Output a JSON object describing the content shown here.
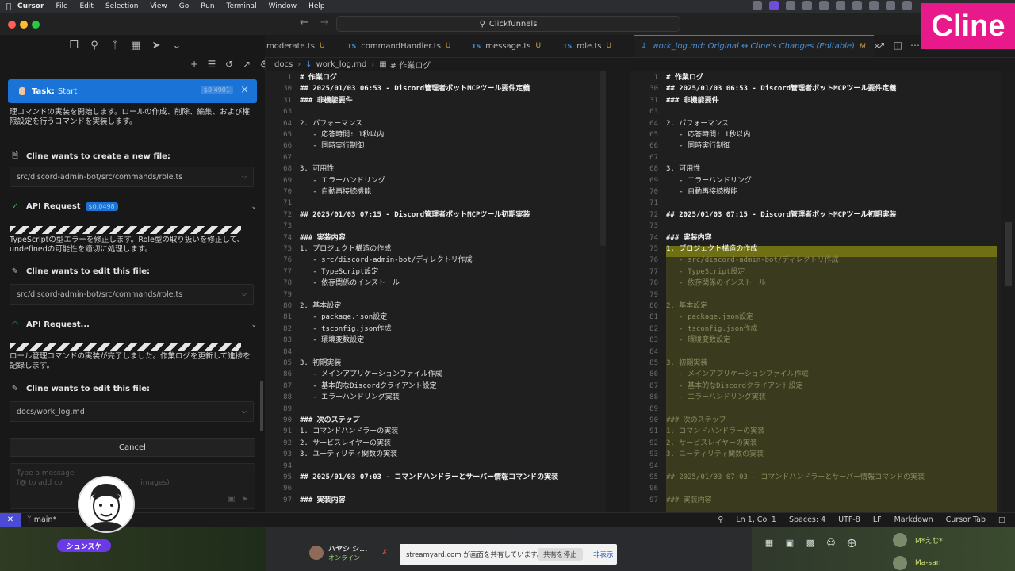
{
  "menubar": {
    "app": "Cursor",
    "items": [
      "File",
      "Edit",
      "Selection",
      "View",
      "Go",
      "Run",
      "Terminal",
      "Window",
      "Help"
    ]
  },
  "titlebar": {
    "search_text": "Clickfunnels"
  },
  "brand": {
    "logo_text": "Cline",
    "logo_color": "#e8198b"
  },
  "sidebar": {
    "task": {
      "label": "Task:",
      "value": "Start",
      "cost": "$0.4901"
    },
    "intro_text": "理コマンドの実装を開始します。ロールの作成、削除、編集、および権限設定を行うコマンドを実装します。",
    "create_file": {
      "title": "Cline wants to create a new file:",
      "path": "src/discord-admin-bot/src/commands/role.ts"
    },
    "api_request": {
      "title": "API Request",
      "cost": "$0.0498"
    },
    "api_text": "TypeScriptの型エラーを修正します。Role型の取り扱いを修正して、undefinedの可能性を適切に処理します。",
    "edit_file_1": {
      "title": "Cline wants to edit this file:",
      "path": "src/discord-admin-bot/src/commands/role.ts"
    },
    "api_request_2": {
      "title": "API Request..."
    },
    "api_text_2": "ロール管理コマンドの実装が完了しました。作業ログを更新して進捗を記録します。",
    "edit_file_2": {
      "title": "Cline wants to edit this file:",
      "path": "docs/work_log.md"
    },
    "cancel_label": "Cancel",
    "input_placeholder_1": "Type a message",
    "input_placeholder_2": "(@ to add co",
    "input_placeholder_3": "images)"
  },
  "avatar": {
    "name": "シュンスケ"
  },
  "tabs": [
    {
      "label": "moderate.ts",
      "badge": "",
      "mod": "U"
    },
    {
      "label": "commandHandler.ts",
      "badge": "TS",
      "mod": "U"
    },
    {
      "label": "message.ts",
      "badge": "TS",
      "mod": "U"
    },
    {
      "label": "role.ts",
      "badge": "TS",
      "mod": "U"
    },
    {
      "label": "work_log.md: Original ↔ Cline's Changes (Editable)",
      "badge": "",
      "mod": "M",
      "active": true
    }
  ],
  "breadcrumb": {
    "folder": "docs",
    "file": "work_log.md",
    "symbol": "# 作業ログ"
  },
  "editor_left": [
    {
      "ln": "1",
      "text": "# 作業ログ",
      "h": true
    },
    {
      "ln": "30",
      "text": "## 2025/01/03 06:53 - Discord管理者ボットMCPツール要件定義",
      "h": true
    },
    {
      "ln": "31",
      "text": "### 非機能要件",
      "h": true
    },
    {
      "ln": "63",
      "text": ""
    },
    {
      "ln": "64",
      "text": "2. パフォーマンス"
    },
    {
      "ln": "65",
      "text": "   - 応答時間: 1秒以内"
    },
    {
      "ln": "66",
      "text": "   - 同時実行制御"
    },
    {
      "ln": "67",
      "text": ""
    },
    {
      "ln": "68",
      "text": "3. 可用性"
    },
    {
      "ln": "69",
      "text": "   - エラーハンドリング"
    },
    {
      "ln": "70",
      "text": "   - 自動再接続機能"
    },
    {
      "ln": "71",
      "text": ""
    },
    {
      "ln": "72",
      "text": "## 2025/01/03 07:15 - Discord管理者ボットMCPツール初期実装",
      "h": true
    },
    {
      "ln": "73",
      "text": ""
    },
    {
      "ln": "74",
      "text": "### 実装内容",
      "h": true
    },
    {
      "ln": "75",
      "text": "1. プロジェクト構造の作成"
    },
    {
      "ln": "76",
      "text": "   - src/discord-admin-bot/ディレクトリ作成"
    },
    {
      "ln": "77",
      "text": "   - TypeScript設定"
    },
    {
      "ln": "78",
      "text": "   - 依存関係のインストール"
    },
    {
      "ln": "79",
      "text": ""
    },
    {
      "ln": "80",
      "text": "2. 基本設定"
    },
    {
      "ln": "81",
      "text": "   - package.json設定"
    },
    {
      "ln": "82",
      "text": "   - tsconfig.json作成"
    },
    {
      "ln": "83",
      "text": "   - 環境変数設定"
    },
    {
      "ln": "84",
      "text": ""
    },
    {
      "ln": "85",
      "text": "3. 初期実装"
    },
    {
      "ln": "86",
      "text": "   - メインアプリケーションファイル作成"
    },
    {
      "ln": "87",
      "text": "   - 基本的なDiscordクライアント設定"
    },
    {
      "ln": "88",
      "text": "   - エラーハンドリング実装"
    },
    {
      "ln": "89",
      "text": ""
    },
    {
      "ln": "90",
      "text": "### 次のステップ",
      "h": true
    },
    {
      "ln": "91",
      "text": "1. コマンドハンドラーの実装"
    },
    {
      "ln": "92",
      "text": "2. サービスレイヤーの実装"
    },
    {
      "ln": "93",
      "text": "3. ユーティリティ関数の実装"
    },
    {
      "ln": "94",
      "text": ""
    },
    {
      "ln": "95",
      "text": "## 2025/01/03 07:03 - コマンドハンドラーとサーバー情報コマンドの実装",
      "h": true
    },
    {
      "ln": "96",
      "text": ""
    },
    {
      "ln": "97",
      "text": "### 実装内容",
      "h": true
    }
  ],
  "editor_right": [
    {
      "ln": "1",
      "text": "# 作業ログ",
      "h": true
    },
    {
      "ln": "30",
      "text": "## 2025/01/03 06:53 - Discord管理者ボットMCPツール要件定義",
      "h": true
    },
    {
      "ln": "31",
      "text": "### 非機能要件",
      "h": true
    },
    {
      "ln": "63",
      "text": ""
    },
    {
      "ln": "64",
      "text": "2. パフォーマンス"
    },
    {
      "ln": "65",
      "text": "   - 応答時間: 1秒以内"
    },
    {
      "ln": "66",
      "text": "   - 同時実行制御"
    },
    {
      "ln": "67",
      "text": ""
    },
    {
      "ln": "68",
      "text": "3. 可用性"
    },
    {
      "ln": "69",
      "text": "   - エラーハンドリング"
    },
    {
      "ln": "70",
      "text": "   - 自動再接続機能"
    },
    {
      "ln": "71",
      "text": ""
    },
    {
      "ln": "72",
      "text": "## 2025/01/03 07:15 - Discord管理者ボットMCPツール初期実装",
      "h": true
    },
    {
      "ln": "73",
      "text": ""
    },
    {
      "ln": "74",
      "text": "### 実装内容",
      "h": true
    },
    {
      "ln": "75",
      "text": "1. プロジェクト構造の作成",
      "hl": true
    },
    {
      "ln": "76",
      "text": "   - src/discord-admin-bot/ディレクトリ作成",
      "dim": true
    },
    {
      "ln": "77",
      "text": "   - TypeScript設定",
      "dim": true
    },
    {
      "ln": "78",
      "text": "   - 依存関係のインストール",
      "dim": true
    },
    {
      "ln": "79",
      "text": "",
      "dim": true
    },
    {
      "ln": "80",
      "text": "2. 基本設定",
      "dim": true
    },
    {
      "ln": "81",
      "text": "   - package.json設定",
      "dim": true
    },
    {
      "ln": "82",
      "text": "   - tsconfig.json作成",
      "dim": true
    },
    {
      "ln": "83",
      "text": "   - 環境変数設定",
      "dim": true
    },
    {
      "ln": "84",
      "text": "",
      "dim": true
    },
    {
      "ln": "85",
      "text": "3. 初期実装",
      "dim": true
    },
    {
      "ln": "86",
      "text": "   - メインアプリケーションファイル作成",
      "dim": true
    },
    {
      "ln": "87",
      "text": "   - 基本的なDiscordクライアント設定",
      "dim": true
    },
    {
      "ln": "88",
      "text": "   - エラーハンドリング実装",
      "dim": true
    },
    {
      "ln": "89",
      "text": "",
      "dim": true
    },
    {
      "ln": "90",
      "text": "### 次のステップ",
      "dim": true
    },
    {
      "ln": "91",
      "text": "1. コマンドハンドラーの実装",
      "dim": true
    },
    {
      "ln": "92",
      "text": "2. サービスレイヤーの実装",
      "dim": true
    },
    {
      "ln": "93",
      "text": "3. ユーティリティ関数の実装",
      "dim": true
    },
    {
      "ln": "94",
      "text": "",
      "dim": true
    },
    {
      "ln": "95",
      "text": "## 2025/01/03 07:03 - コマンドハンドラーとサーバー情報コマンドの実装",
      "dim": true
    },
    {
      "ln": "96",
      "text": "",
      "dim": true
    },
    {
      "ln": "97",
      "text": "### 実装内容",
      "dim": true
    }
  ],
  "statusbar": {
    "branch": "main*",
    "position": "Ln 1, Col 1",
    "spaces": "Spaces: 4",
    "encoding": "UTF-8",
    "eol": "LF",
    "language": "Markdown",
    "mode": "Cursor Tab"
  },
  "stream": {
    "user_name": "ハヤシ シ...",
    "user_status": "オンライン",
    "share_text": "streamyard.com が画面を共有しています。",
    "stop_label": "共有を停止",
    "hide_label": "非表示",
    "peer_1": "M*えむ*",
    "peer_2": "Ma-san"
  }
}
